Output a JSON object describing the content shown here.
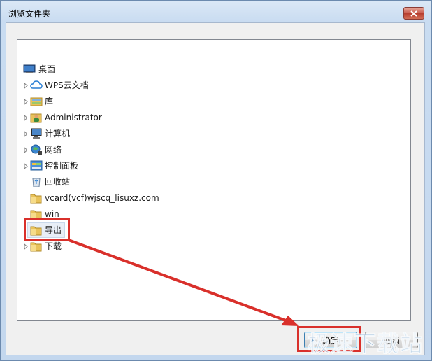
{
  "window": {
    "title": "浏览文件夹"
  },
  "tree": {
    "items": [
      {
        "label": "桌面",
        "icon": "desktop-icon",
        "expandable": false
      },
      {
        "label": "WPS云文档",
        "icon": "cloud-icon",
        "expandable": true
      },
      {
        "label": "库",
        "icon": "library-icon",
        "expandable": true
      },
      {
        "label": "Administrator",
        "icon": "user-folder-icon",
        "expandable": true
      },
      {
        "label": "计算机",
        "icon": "computer-icon",
        "expandable": true
      },
      {
        "label": "网络",
        "icon": "network-icon",
        "expandable": true
      },
      {
        "label": "控制面板",
        "icon": "control-panel-icon",
        "expandable": true
      },
      {
        "label": "回收站",
        "icon": "recycle-bin-icon",
        "expandable": false
      },
      {
        "label": "vcard(vcf)wjscq_lisuxz.com",
        "icon": "folder-icon",
        "expandable": false
      },
      {
        "label": "win",
        "icon": "folder-icon",
        "expandable": false
      },
      {
        "label": "导出",
        "icon": "folder-icon",
        "expandable": false,
        "selected": true
      },
      {
        "label": "下载",
        "icon": "folder-icon",
        "expandable": true
      }
    ]
  },
  "buttons": {
    "ok_label": "确定",
    "cancel_label": "取消"
  },
  "watermark": "极速下载站",
  "colors": {
    "annotation": "#d9302b",
    "folder": "#e8c25a",
    "title_bg": "#c9dcf1"
  }
}
